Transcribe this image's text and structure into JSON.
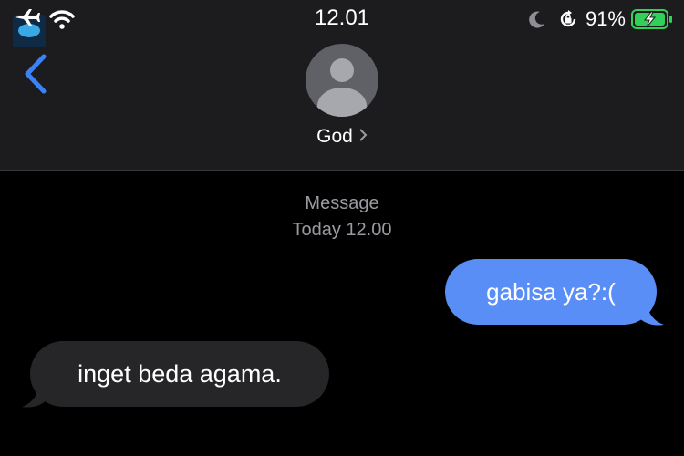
{
  "status_bar": {
    "time": "12.01",
    "battery_percent": "91%",
    "icons": [
      "airplane-icon",
      "wifi-icon",
      "moon-icon",
      "rotation-lock-icon",
      "battery-charging-icon"
    ],
    "battery_color": "#30d158"
  },
  "header": {
    "contact_name": "God",
    "back_icon": "chevron-left-icon",
    "accent": "#3b82f6"
  },
  "thread": {
    "label": "Message",
    "timestamp": "Today 12.00",
    "messages": [
      {
        "direction": "outgoing",
        "text": "gabisa ya?:(",
        "color": "#5a8ef7"
      },
      {
        "direction": "incoming",
        "text": "inget beda agama.",
        "color": "#262628"
      }
    ]
  }
}
